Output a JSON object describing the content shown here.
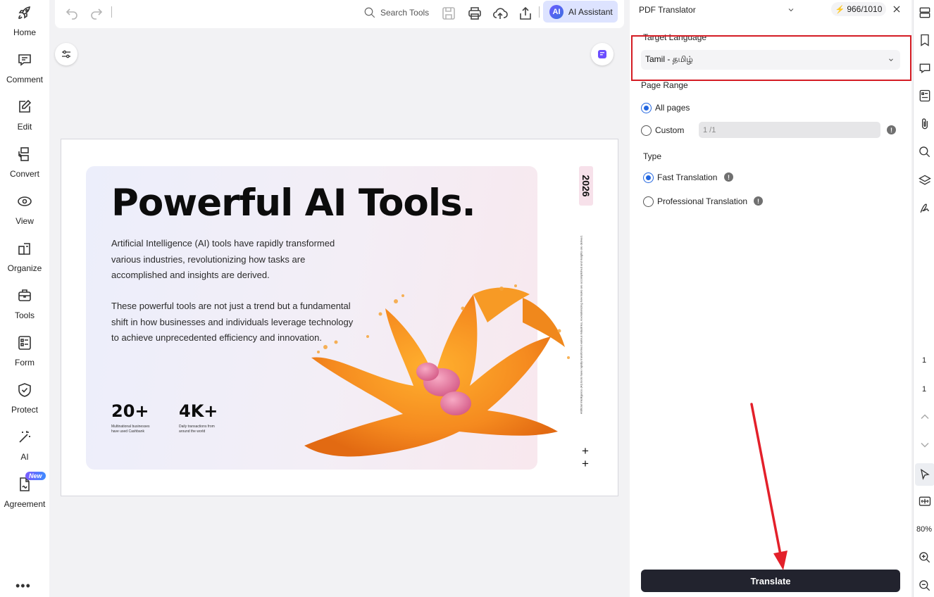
{
  "sidebar": {
    "items": [
      {
        "label": "Home",
        "icon": "rocket-icon"
      },
      {
        "label": "Comment",
        "icon": "comment-icon"
      },
      {
        "label": "Edit",
        "icon": "edit-icon"
      },
      {
        "label": "Convert",
        "icon": "convert-icon"
      },
      {
        "label": "View",
        "icon": "eye-icon"
      },
      {
        "label": "Organize",
        "icon": "organize-icon"
      },
      {
        "label": "Tools",
        "icon": "toolbox-icon"
      },
      {
        "label": "Form",
        "icon": "form-icon"
      },
      {
        "label": "Protect",
        "icon": "shield-icon"
      },
      {
        "label": "AI",
        "icon": "magic-wand-icon"
      },
      {
        "label": "Agreement",
        "icon": "agreement-icon",
        "badge": "New"
      }
    ],
    "more": "•••"
  },
  "toolbar": {
    "search_label": "Search Tools",
    "ai_badge": "AI",
    "ai_label": "AI Assistant"
  },
  "document": {
    "title": "Powerful AI Tools.",
    "paragraph1": "Artificial Intelligence (AI) tools have rapidly transformed various industries, revolutionizing how tasks are accomplished and insights are derived.",
    "paragraph2": "These powerful tools are not just a trend but a fundamental shift in how businesses and individuals leverage technology to achieve unprecedented efficiency and innovation.",
    "stats": [
      {
        "value": "20+",
        "caption": "Multinational businesses have used Cashbank"
      },
      {
        "value": "4K+",
        "caption": "Daily transactions from around the world"
      }
    ],
    "year": "2026",
    "side_note": "Artificial Intelligence (AI) tools have rapidly transformed various industries, revolutionizing how tasks are accomplished and insights are derived.",
    "plus_marks": "+\n+"
  },
  "translator": {
    "panel_title": "PDF Translator",
    "credits": "966/1010",
    "target_language_label": "Target Language",
    "target_language_value": "Tamil - தமிழ்",
    "page_range_label": "Page Range",
    "all_pages_label": "All pages",
    "custom_label": "Custom",
    "custom_range_value": "1 /1",
    "type_label": "Type",
    "fast_label": "Fast Translation",
    "professional_label": "Professional Translation",
    "info_glyph": "!",
    "translate_button": "Translate"
  },
  "right_rail": {
    "page_current": "1",
    "page_total": "1",
    "zoom": "80%"
  },
  "colors": {
    "accent": "#2266e0",
    "highlight": "#d41c24",
    "translate_bg": "#22232e"
  }
}
